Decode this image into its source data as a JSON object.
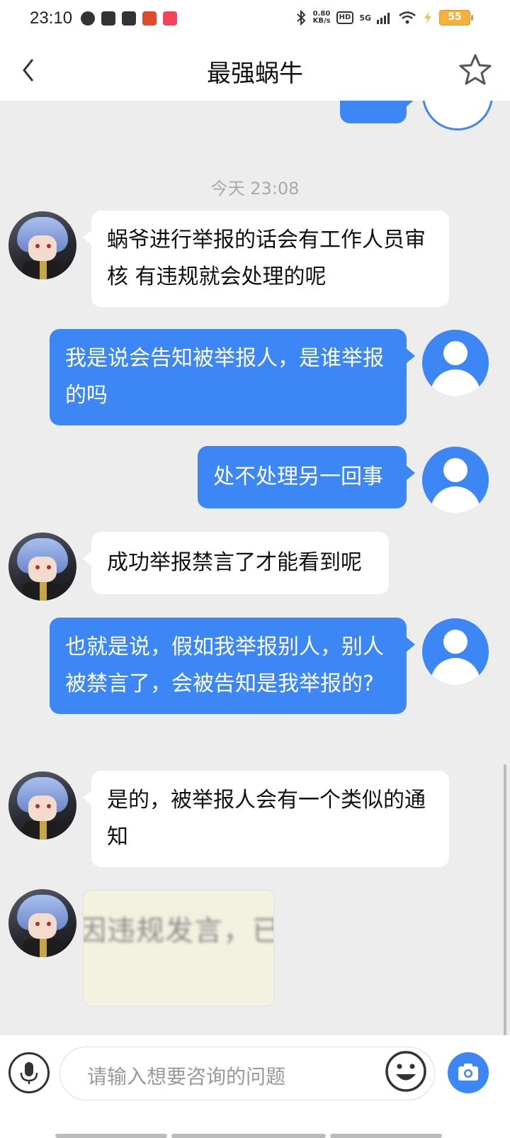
{
  "status_bar": {
    "time": "23:10",
    "net_speed_value": "0.80",
    "net_speed_unit": "KB/s",
    "hd_label": "HD",
    "network": "5G",
    "battery": "55"
  },
  "header": {
    "title": "最强蜗牛"
  },
  "chat": {
    "timestamp": "今天 23:08",
    "messages": [
      {
        "from": "bot",
        "text": "蜗爷进行举报的话会有工作人员审核 有违规就会处理的呢"
      },
      {
        "from": "user",
        "text": "我是说会告知被举报人，是谁举报的吗"
      },
      {
        "from": "user",
        "text": "处不处理另一回事"
      },
      {
        "from": "bot",
        "text": "成功举报禁言了才能看到呢"
      },
      {
        "from": "user",
        "text": "也就是说，假如我举报别人，别人被禁言了，会被告知是我举报的?"
      },
      {
        "from": "bot",
        "text": "是的，被举报人会有一个类似的通知"
      }
    ],
    "image_message_text": "因违规发言，已"
  },
  "input": {
    "placeholder": "请输入想要咨询的问题"
  },
  "colors": {
    "accent": "#3d86f5",
    "background": "#ededed"
  }
}
